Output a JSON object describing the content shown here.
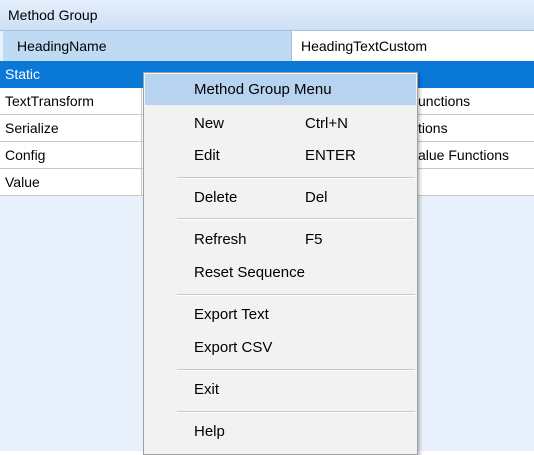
{
  "window": {
    "title": "Method Group"
  },
  "grid": {
    "columns": [
      "HeadingName",
      "HeadingTextCustom"
    ],
    "rows": [
      {
        "name": "Static",
        "visible_text": ""
      },
      {
        "name": "TextTransform",
        "visible_text": "unctions"
      },
      {
        "name": "Serialize",
        "visible_text": "tions"
      },
      {
        "name": "Config",
        "visible_text": "alue Functions"
      },
      {
        "name": "Value",
        "visible_text": ""
      }
    ],
    "selected_row": "Static",
    "colors": {
      "selection": "#0a78d7",
      "header": "#bfdbf4",
      "background": "#e8f1fb"
    }
  },
  "context_menu": {
    "title": "Method Group Menu",
    "items": [
      {
        "label": "New",
        "shortcut": "Ctrl+N"
      },
      {
        "label": "Edit",
        "shortcut": "ENTER"
      },
      {
        "label": "Delete",
        "shortcut": "Del"
      },
      {
        "label": "Refresh",
        "shortcut": "F5"
      },
      {
        "label": "Reset Sequence",
        "shortcut": ""
      },
      {
        "label": "Export Text",
        "shortcut": ""
      },
      {
        "label": "Export CSV",
        "shortcut": ""
      },
      {
        "label": "Exit",
        "shortcut": ""
      },
      {
        "label": "Help",
        "shortcut": ""
      }
    ]
  }
}
